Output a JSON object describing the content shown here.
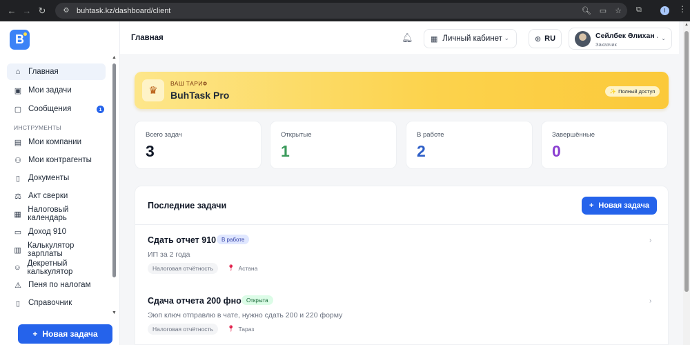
{
  "browser": {
    "url": "buhtask.kz/dashboard/client",
    "profile_initial": "I"
  },
  "logo": {
    "letter": "B"
  },
  "sidebar": {
    "items": [
      {
        "label": "Главная",
        "icon": "home-icon",
        "active": true
      },
      {
        "label": "Мои задачи",
        "icon": "briefcase-icon"
      },
      {
        "label": "Сообщения",
        "icon": "chat-icon",
        "badge": "1"
      },
      {
        "label": "Мои компании",
        "icon": "building-icon"
      },
      {
        "label": "Мои контрагенты",
        "icon": "users-icon"
      },
      {
        "label": "Документы",
        "icon": "document-icon"
      },
      {
        "label": "Акт сверки",
        "icon": "scales-icon"
      },
      {
        "label": "Налоговый календарь",
        "icon": "calendar-icon"
      },
      {
        "label": "Доход 910",
        "icon": "receipt-icon"
      },
      {
        "label": "Калькулятор зарплаты",
        "icon": "calculator-icon"
      },
      {
        "label": "Декретный калькулятор",
        "icon": "baby-icon"
      },
      {
        "label": "Пеня по налогам",
        "icon": "warning-icon"
      },
      {
        "label": "Справочник",
        "icon": "book-icon"
      }
    ],
    "section_label": "ИНСТРУМЕНТЫ",
    "new_task_label": "Новая задача"
  },
  "header": {
    "title": "Главная",
    "cabinet_label": "Личный кабинет",
    "lang": "RU",
    "user_name": "Сейлбек Әлихан ...",
    "user_role": "Заказчик"
  },
  "plan": {
    "label": "ВАШ ТАРИФ",
    "name": "BuhTask Pro",
    "badge": "Полный доступ"
  },
  "stats": [
    {
      "label": "Всего задач",
      "value": "3",
      "color": "#111827"
    },
    {
      "label": "Открытые",
      "value": "1",
      "color": "#3a9a5b"
    },
    {
      "label": "В работе",
      "value": "2",
      "color": "#2f5fc7"
    },
    {
      "label": "Завершённые",
      "value": "0",
      "color": "#8a3fd1"
    }
  ],
  "tasks": {
    "title": "Последние задачи",
    "new_task_label": "Новая задача",
    "items": [
      {
        "title": "Сдать отчет 910",
        "status": "В работе",
        "status_bg": "#e0e7ff",
        "status_fg": "#3744a8",
        "desc": "ИП за 2 года",
        "tag": "Налоговая отчётность",
        "location": "Астана"
      },
      {
        "title": "Сдача отчета 200 фно",
        "status": "Открыта",
        "status_bg": "#dcfce7",
        "status_fg": "#166534",
        "desc": "Эюп ключ отправлю в чате, нужно сдать 200 и 220 форму",
        "tag": "Налоговая отчётность",
        "location": "Тараз"
      }
    ]
  }
}
